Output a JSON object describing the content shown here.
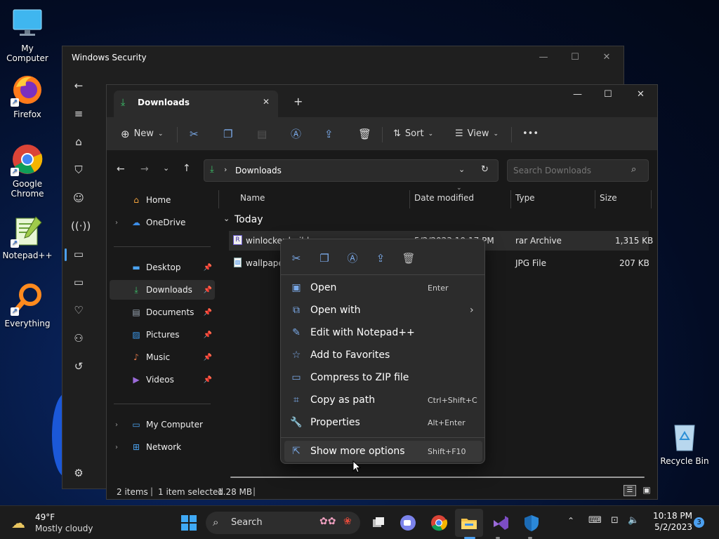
{
  "desktop": {
    "icons": [
      {
        "label": "My Computer",
        "icon": "monitor-icon"
      },
      {
        "label": "Firefox",
        "icon": "firefox-icon"
      },
      {
        "label": "Google Chrome",
        "icon": "chrome-icon"
      },
      {
        "label": "Notepad++",
        "icon": "notepadpp-icon"
      },
      {
        "label": "Everything",
        "icon": "everything-icon"
      },
      {
        "label": "Recycle Bin",
        "icon": "recycle-bin-icon"
      }
    ]
  },
  "security_window": {
    "title": "Windows Security"
  },
  "explorer": {
    "tab_title": "Downloads",
    "toolbar": {
      "new_label": "New",
      "sort_label": "Sort",
      "view_label": "View",
      "more_label": "•••"
    },
    "address": {
      "path": "Downloads",
      "search_placeholder": "Search Downloads"
    },
    "nav": {
      "home": "Home",
      "onedrive": "OneDrive",
      "quick": [
        {
          "label": "Desktop",
          "icon": "desktop-folder-icon"
        },
        {
          "label": "Downloads",
          "icon": "download-arrow-icon"
        },
        {
          "label": "Documents",
          "icon": "documents-icon"
        },
        {
          "label": "Pictures",
          "icon": "pictures-icon"
        },
        {
          "label": "Music",
          "icon": "music-icon"
        },
        {
          "label": "Videos",
          "icon": "videos-icon"
        }
      ],
      "my_computer": "My Computer",
      "network": "Network"
    },
    "columns": {
      "name": "Name",
      "date": "Date modified",
      "type": "Type",
      "size": "Size"
    },
    "group_label": "Today",
    "files": [
      {
        "name": "winlocker builder",
        "date": "5/2/2023 10:17 PM",
        "type": "rar Archive",
        "size": "1,315 KB"
      },
      {
        "name": "wallpaper",
        "date": "",
        "type": "JPG File",
        "size": "207 KB"
      }
    ],
    "status": {
      "items": "2 items",
      "selected": "1 item selected",
      "size": "1.28 MB"
    }
  },
  "context_menu": {
    "items": [
      {
        "label": "Open",
        "key": "Enter",
        "icon": "open-app-icon"
      },
      {
        "label": "Open with",
        "key": "›",
        "icon": "open-with-icon"
      },
      {
        "label": "Edit with Notepad++",
        "key": "",
        "icon": "pin-icon"
      },
      {
        "label": "Add to Favorites",
        "key": "",
        "icon": "star-icon"
      },
      {
        "label": "Compress to ZIP file",
        "key": "",
        "icon": "zip-icon"
      },
      {
        "label": "Copy as path",
        "key": "Ctrl+Shift+C",
        "icon": "copy-path-icon"
      },
      {
        "label": "Properties",
        "key": "Alt+Enter",
        "icon": "wrench-icon"
      }
    ],
    "more": {
      "label": "Show more options",
      "key": "Shift+F10"
    }
  },
  "taskbar": {
    "weather_temp": "49°F",
    "weather_desc": "Mostly cloudy",
    "search_label": "Search",
    "time": "10:18 PM",
    "date": "5/2/2023",
    "notification_count": "3"
  }
}
